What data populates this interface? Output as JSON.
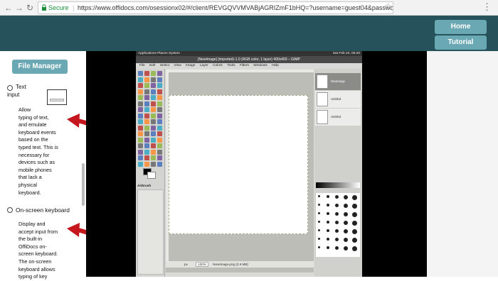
{
  "browser": {
    "secure_label": "Secure",
    "url": "https://www.offidocs.com/osessionx02/#/client/REVGQVVMVABjAGRIZmF1bHQ=?username=guest04&passwo...",
    "icons": {
      "back": "back-arrow-icon",
      "forward": "forward-arrow-icon",
      "reload": "reload-icon",
      "lock": "lock-icon",
      "star": "bookmark-star-icon",
      "menu": "kebab-menu-icon"
    }
  },
  "header": {
    "home_label": "Home",
    "tutorial_label": "Tutorial"
  },
  "sidebar": {
    "file_manager_label": "File Manager",
    "options": [
      {
        "label_line1": "Text",
        "label_line2": "input",
        "description": [
          "Allow",
          "typing of text,",
          "and emulate",
          "keyboard events",
          "based on the",
          "typed text. This is",
          "necessary for",
          "devices such as",
          "mobile phones",
          "that lack a",
          "physical",
          "keyboard."
        ]
      },
      {
        "label": "On-screen keyboard",
        "description": [
          "Display and",
          "accept input from",
          "the built-in",
          "OffiDocs on-",
          "screen keyboard.",
          "The on-screen",
          "keyboard allows",
          "typing of key"
        ]
      }
    ]
  },
  "gimp": {
    "topbar_left": "Applications  Places  System",
    "topbar_right": "Sat Feb 24, 05:20",
    "window_title": "[NewImage] (imported)-1.0 (RGB color, 1 layer) 400x400 – GIMP",
    "menu": [
      "File",
      "Edit",
      "Select",
      "View",
      "Image",
      "Layer",
      "Colors",
      "Tools",
      "Filters",
      "Windows",
      "Help"
    ],
    "status": "NewImage.png (2.6 MB)",
    "zoom": "100%",
    "unit": "px",
    "tool_options_title": "Airbrush",
    "layers": [
      "NewImage",
      "Untitled",
      "Untitled"
    ]
  },
  "colors": {
    "header_bg": "#26535b",
    "button_bg": "#6aa8b3",
    "secure_green": "#1e8e3e",
    "arrow_red": "#c4161c"
  }
}
